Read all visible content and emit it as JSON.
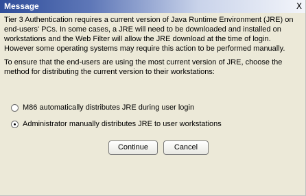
{
  "window": {
    "title": "Message",
    "close_glyph": "X"
  },
  "message": {
    "paragraph1": "Tier 3 Authentication requires a current version of Java Runtime Environment (JRE) on end-users' PCs.  In some cases, a JRE will need to be downloaded and installed on workstations and the Web Filter will allow the JRE download at the time of login. However some operating systems may require this action to be performed manually.",
    "paragraph2": "To ensure that the end-users are using the most current version of JRE, choose the method for distributing the current version to their workstations:"
  },
  "options": [
    {
      "label": "M86 automatically distributes JRE during user login",
      "selected": false
    },
    {
      "label": "Administrator manually distributes JRE to user workstations",
      "selected": true
    }
  ],
  "buttons": {
    "continue_label": "Continue",
    "cancel_label": "Cancel"
  }
}
